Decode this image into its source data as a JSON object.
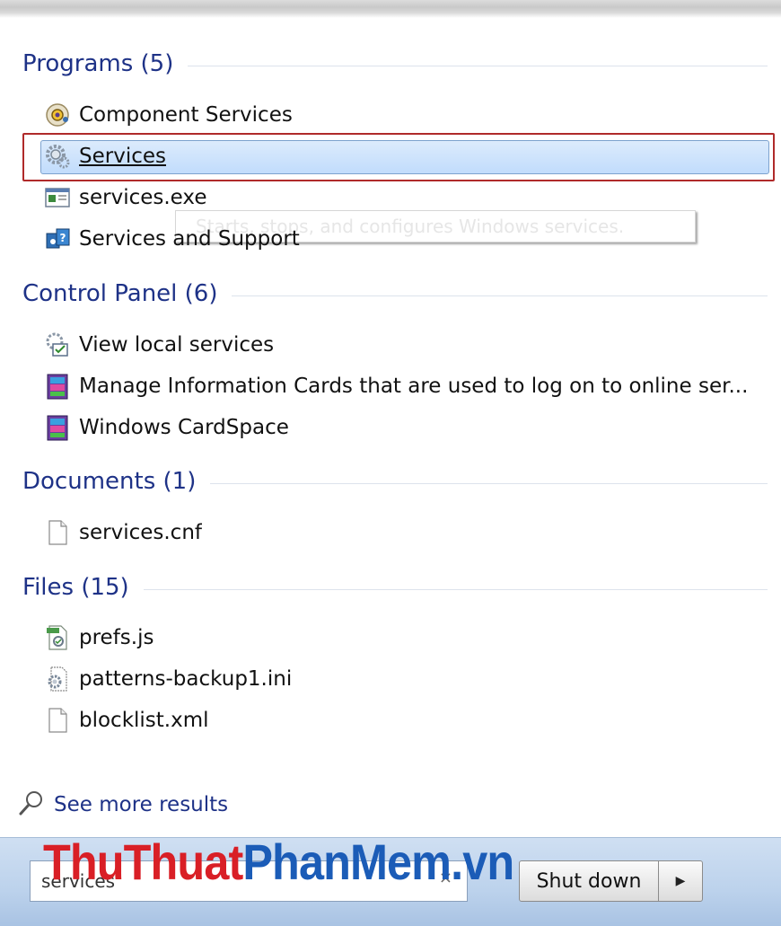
{
  "sections": {
    "programs": {
      "title": "Programs (5)",
      "items": [
        {
          "label": "Component Services",
          "icon": "component-services-icon"
        },
        {
          "label": "Services",
          "icon": "services-gear-icon"
        },
        {
          "label": "services.exe",
          "icon": "exe-window-icon"
        },
        {
          "label": "Services and Support",
          "icon": "help-support-icon"
        }
      ]
    },
    "control_panel": {
      "title": "Control Panel (6)",
      "items": [
        {
          "label": "View local services",
          "icon": "local-services-icon"
        },
        {
          "label": "Manage Information Cards that are used to log on to online ser...",
          "icon": "cardspace-icon"
        },
        {
          "label": "Windows CardSpace",
          "icon": "cardspace-icon"
        }
      ]
    },
    "documents": {
      "title": "Documents (1)",
      "items": [
        {
          "label": "services.cnf",
          "icon": "document-icon"
        }
      ]
    },
    "files": {
      "title": "Files (15)",
      "items": [
        {
          "label": "prefs.js",
          "icon": "script-file-icon"
        },
        {
          "label": "patterns-backup1.ini",
          "icon": "settings-file-icon"
        },
        {
          "label": "blocklist.xml",
          "icon": "document-icon"
        }
      ]
    }
  },
  "tooltip": "Starts, stops, and configures Windows services.",
  "see_more": {
    "label": "See more results",
    "icon": "search-icon"
  },
  "search": {
    "value": "services",
    "clear_icon": "clear-icon"
  },
  "shutdown": {
    "label": "Shut down",
    "arrow_icon": "arrow-right-icon"
  },
  "watermark": {
    "part1": "ThuThuat",
    "part2": "PhanMem",
    "part3": ".vn"
  },
  "colors": {
    "header": "#1e3287",
    "selection_border": "#b02a2a",
    "selection_fill": "#c1dcfc"
  }
}
